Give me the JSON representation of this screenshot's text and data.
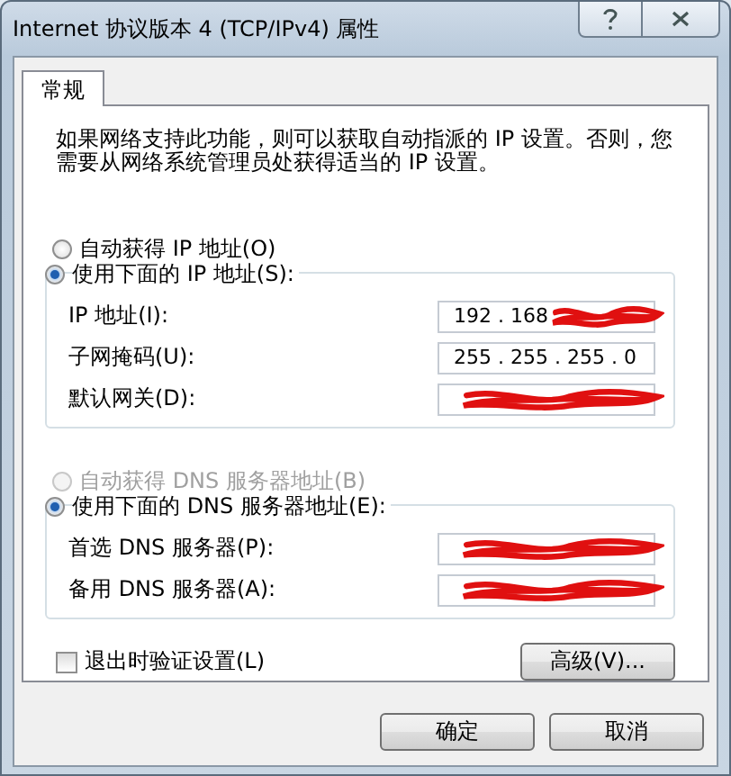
{
  "window": {
    "title": "Internet 协议版本 4 (TCP/IPv4) 属性"
  },
  "tabs": [
    {
      "label": "常规",
      "selected": true
    }
  ],
  "description": "如果网络支持此功能，则可以获取自动指派的 IP 设置。否则，您需要从网络系统管理员处获得适当的 IP 设置。",
  "ip_section": {
    "options": [
      {
        "label": "自动获得 IP 地址(O)",
        "selected": false,
        "disabled": false
      },
      {
        "label": "使用下面的 IP 地址(S):",
        "selected": true,
        "disabled": false
      }
    ],
    "fields": [
      {
        "label": "IP 地址(I):",
        "value": "192 . 168",
        "redacted": true
      },
      {
        "label": "子网掩码(U):",
        "value": "255 . 255 . 255 . 0",
        "redacted": false
      },
      {
        "label": "默认网关(D):",
        "redacted": true
      }
    ]
  },
  "dns_section": {
    "options": [
      {
        "label": "自动获得 DNS 服务器地址(B)",
        "selected": false,
        "disabled": true
      },
      {
        "label": "使用下面的 DNS 服务器地址(E):",
        "selected": true,
        "disabled": false
      }
    ],
    "fields": [
      {
        "label": "首选 DNS 服务器(P):",
        "redacted": true
      },
      {
        "label": "备用 DNS 服务器(A):",
        "redacted": true
      }
    ]
  },
  "validate_checkbox": {
    "label": "退出时验证设置(L)",
    "checked": false
  },
  "advanced_button": "高级(V)...",
  "buttons": [
    "确定",
    "取消"
  ]
}
